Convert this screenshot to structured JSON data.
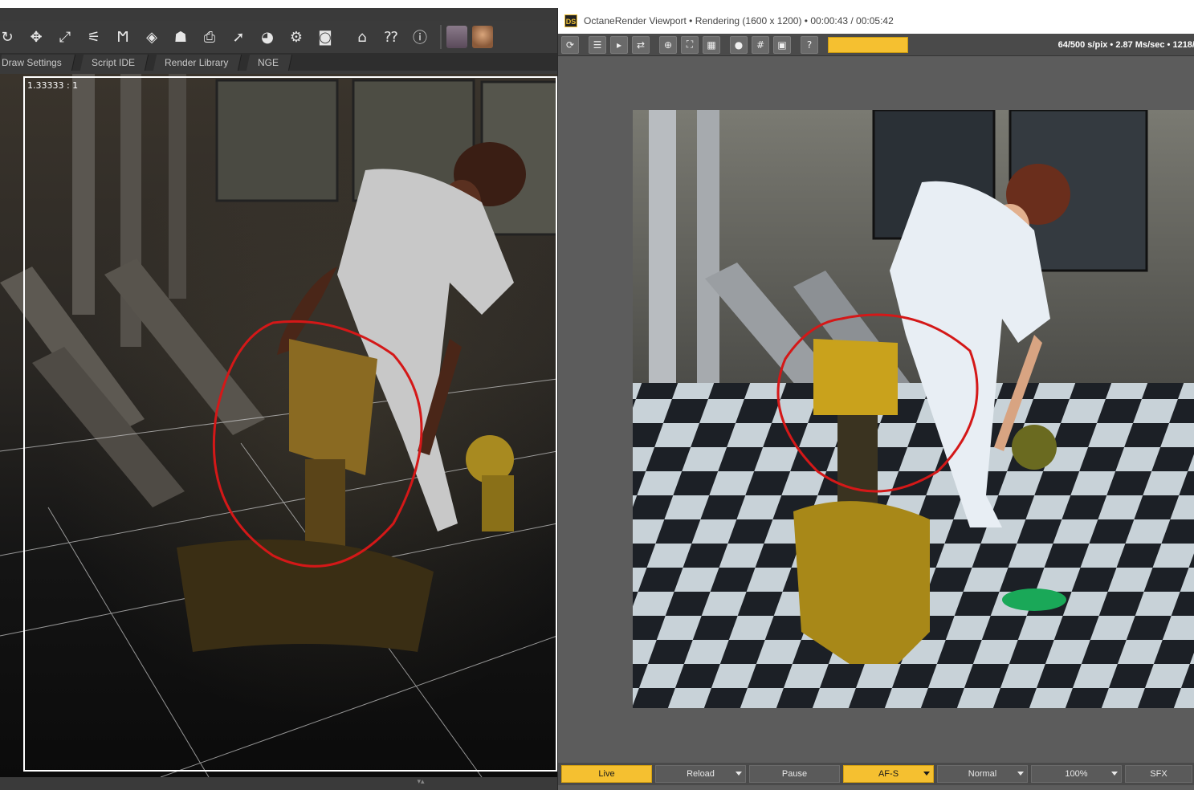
{
  "left_panel": {
    "toolbar_icons": [
      "rotate-tool-icon",
      "translate-tool-icon",
      "scale-tool-icon",
      "joint-editor-icon",
      "geometry-editor-icon",
      "surface-selection-icon",
      "figure-select-icon",
      "camera-icon",
      "pointer-icon",
      "spot-render-icon",
      "render-settings-icon",
      "render-icon",
      "daz-home-icon",
      "whats-this-icon",
      "help-icon",
      "figure-thumbnail-icon",
      "face-thumbnail-icon"
    ],
    "tabs": [
      "Draw Settings",
      "Script IDE",
      "Render Library",
      "NGE"
    ],
    "frame_ratio": "1.33333 : 1"
  },
  "octane": {
    "logo": "DS",
    "title": "OctaneRender Viewport • Rendering (1600 x 1200) • 00:00:43 / 00:05:42",
    "stats": "64/500 s/pix • 2.87 Ms/sec • 1218/",
    "progress": 0.2,
    "bottom_buttons": [
      {
        "label": "Live",
        "active": true,
        "dropdown": false
      },
      {
        "label": "Reload",
        "active": false,
        "dropdown": true
      },
      {
        "label": "Pause",
        "active": false,
        "dropdown": false
      },
      {
        "label": "AF-S",
        "active": true,
        "dropdown": true
      },
      {
        "label": "Normal",
        "active": false,
        "dropdown": true
      },
      {
        "label": "100%",
        "active": false,
        "dropdown": true
      },
      {
        "label": "SFX",
        "active": false,
        "dropdown": false
      }
    ]
  },
  "colors": {
    "accent_yellow": "#f5c030",
    "annotation_red": "#d41818"
  }
}
